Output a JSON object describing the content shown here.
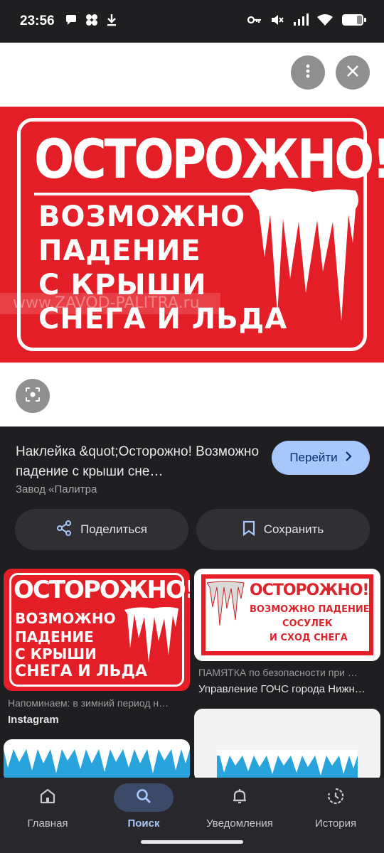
{
  "status_bar": {
    "time": "23:56"
  },
  "viewer": {
    "sign": {
      "title": "ОСТОРОЖНО!",
      "line1": "ВОЗМОЖНО",
      "line2": "ПАДЕНИЕ",
      "line3": "С КРЫШИ",
      "line4": "СНЕГА И ЛЬДА",
      "watermark": "www.ZAVOD-PALITRA.ru"
    }
  },
  "result": {
    "title": "Наклейка &quot;Осторожно! Возможно падение с крыши сне…",
    "source": "Завод «Палитра",
    "goto_label": "Перейти",
    "share_label": "Поделиться",
    "save_label": "Сохранить"
  },
  "grid": {
    "card1": {
      "title": "ОСТОРОЖНО!",
      "text1": "ВОЗМОЖНО",
      "text2": "ПАДЕНИЕ",
      "text3": "С КРЫШИ",
      "text4": "СНЕГА И ЛЬДА",
      "caption": "Напоминаем: в зимний период н…",
      "source": "Instagram"
    },
    "card2": {
      "title": "ОСТОРОЖНО!",
      "text1": "ВОЗМОЖНО ПАДЕНИЕ",
      "text2": "СОСУЛЕК",
      "text3": "И СХОД СНЕГА",
      "caption": "ПАМЯТКА по безопасности при …",
      "source": "Управление ГОЧС города Нижн…"
    }
  },
  "nav": {
    "items": [
      {
        "label": "Главная",
        "icon": "home-icon"
      },
      {
        "label": "Поиск",
        "icon": "search-icon",
        "active": true
      },
      {
        "label": "Уведомления",
        "icon": "bell-icon"
      },
      {
        "label": "История",
        "icon": "history-icon"
      }
    ]
  },
  "colors": {
    "sign_red": "#e41e26",
    "accent": "#a8c7fa",
    "background": "#1f1f22"
  }
}
